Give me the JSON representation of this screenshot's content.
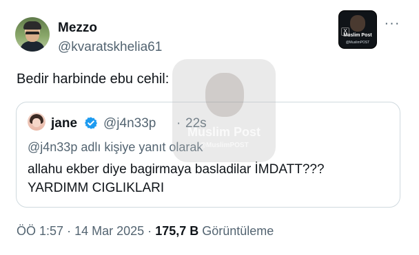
{
  "author": {
    "name": "Mezzo",
    "handle": "@kvaratskhelia61"
  },
  "post": {
    "text": "Bedir harbinde ebu cehil:"
  },
  "badge": {
    "x_icon": "X",
    "title": "Muslim Post",
    "subtitle": "@MuslimPOST"
  },
  "menu": {
    "more_label": "···"
  },
  "watermark": {
    "title": "Muslim Post",
    "subtitle": "@MuslimPOST"
  },
  "quote": {
    "name": "jane",
    "handle": "@j4n33p",
    "separator": "·",
    "time": "22s",
    "reply_context": "@j4n33p adlı kişiye yanıt olarak",
    "line1": "allahu ekber diye bagirmaya basladilar İMDATT???",
    "line2": "YARDIMM CIGLIKLARI",
    "verified_color": "#1d9bf0"
  },
  "meta": {
    "time": "ÖÖ 1:57",
    "dot1": "·",
    "date": "14 Mar 2025",
    "dot2": "·",
    "views_count": "175,7 B",
    "views_label": "Görüntüleme"
  },
  "icons": {
    "verified": "verified-badge-icon",
    "more": "more-options-icon"
  }
}
